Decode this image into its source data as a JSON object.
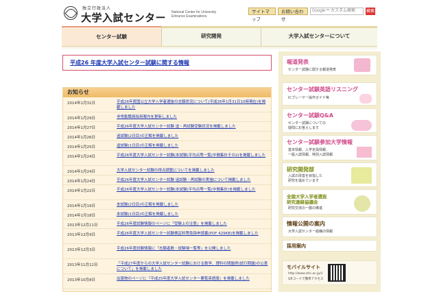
{
  "header": {
    "org_small": "独立行政法人",
    "org_name": "大学入試センター",
    "org_english": "National Center for University Entrance Examinations",
    "sitemap_label": "サイトマップ",
    "inquiry_label": "お問い合わせ",
    "search_placeholder": "Google™ カスタム検索",
    "search_button": "検索"
  },
  "nav": {
    "items": [
      {
        "label": "センター試験"
      },
      {
        "label": "研究開発"
      },
      {
        "label": "大学入試センターについて"
      }
    ]
  },
  "banner": {
    "text": "平成26 年度大学入試センター試験に関する情報"
  },
  "notice": {
    "title": "お知らせ",
    "rows": [
      {
        "date": "2014年1月31日",
        "text": "平成26年度国公立大学入学者選抜の志願状況について(平成26年1月31日10時現在)を掲載しました"
      },
      {
        "date": "2014年1月29日",
        "text": "非常勤職員採用案内を更新しました"
      },
      {
        "date": "2014年1月27日",
        "text": "平成26年度大学入試センター試験 追・再試験受験状況を掲載しました"
      },
      {
        "date": "2014年1月26日",
        "text": "追試験(2日目)の正解を掲載しました"
      },
      {
        "date": "2014年1月25日",
        "text": "追試験(1日目)の正解を掲載しました"
      },
      {
        "date": "2014年1月24日",
        "text": "平成26年度大学入試センター試験(本試験)平均点等一覧(中間集計その2)を掲載しました"
      },
      {
        "date": "2014年1月24日",
        "text": "大学入試センター試験の得点調整についてを掲載しました"
      },
      {
        "date": "2014年1月24日",
        "text": "平成26年度大学入試センター試験 追試験・再試験の実施について掲載しました"
      },
      {
        "date": "2014年1月22日",
        "text": "平成26年度大学入試センター試験(本試験)平均点等一覧(中間集計)を掲載しました"
      },
      {
        "date": "2014年1月19日",
        "text": "本試験(2日目)の正解を掲載しました"
      },
      {
        "date": "2014年1月18日",
        "text": "本試験(1日目)の正解を掲載しました"
      },
      {
        "date": "2013年12月11日",
        "text": "平成26年度試験情報のページに「受験上の注意」を掲載しました"
      },
      {
        "date": "2013年12月9日",
        "text": "平成26年度大学入試センター試験検定料等免除申請書(PDF 429KB)を掲載しました"
      },
      {
        "date": "2013年12月3日",
        "text": "平成26年度試験情報に「志願者数・試験場一覧等」を公開しました"
      },
      {
        "date": "2013年11月12日",
        "text": "「平成27年度からの大学入試センター試験における数学、理科の問題例(試行問題)の公表について」を掲載しました"
      },
      {
        "date": "2013年10月8日",
        "text": "出版物のページに『平成25年度大学入試センター要覧英語版』を掲載しました"
      }
    ]
  },
  "sidebar": {
    "press": {
      "title": "報道発表",
      "sub": "センター試験に関する報道発表"
    },
    "listening": {
      "title": "センター試験英語リスニング",
      "sub": "ICプレーヤー操作ガイド等"
    },
    "qa": {
      "title": "センター試験Q&A",
      "sub1": "センター試験についての",
      "sub2": "疑問にお答えします"
    },
    "participating": {
      "title": "センター試験参加大学情報",
      "sub1": "基本情報、入学定員情報、",
      "sub2": "一般入試情報、特別入試情報"
    },
    "research": {
      "title": "研究開発部",
      "sub1": "入試の改善を目指した",
      "sub2": "研究を進めています"
    },
    "council": {
      "title1": "全国大学入学者選抜",
      "title2": "研究連絡協議会",
      "sub": "研究交流の一層の推進"
    },
    "disclosure": {
      "title": "情報公開の案内",
      "sub": "大学入試センター組織の情報"
    },
    "recruit": {
      "title": "採用案内"
    },
    "mobile": {
      "title": "モバイルサイト",
      "url": "http://www.dnc.ac.jp/i/",
      "sub": "QRコードで簡単アクセス"
    }
  }
}
